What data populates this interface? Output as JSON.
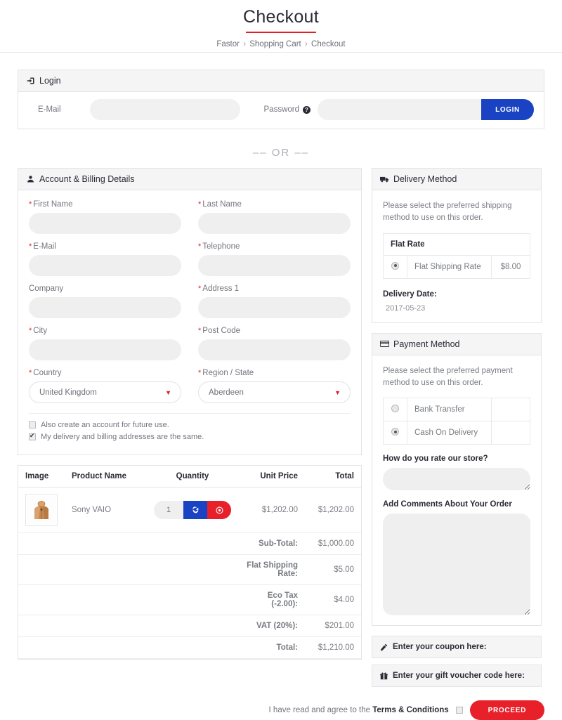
{
  "header": {
    "title": "Checkout",
    "breadcrumb": [
      "Fastor",
      "Shopping Cart",
      "Checkout"
    ],
    "separator": "›",
    "accent_color": "#e02127"
  },
  "login": {
    "panel_title": "Login",
    "icon": "sign-in-icon",
    "email_label": "E-Mail",
    "email_value": "",
    "password_label": "Password",
    "password_help_icon": "question-circle-icon",
    "password_value": "",
    "button_label": "LOGIN",
    "button_color": "#1a43c4"
  },
  "divider": {
    "text": "–– OR ––"
  },
  "billing": {
    "panel_title": "Account & Billing Details",
    "icon": "user-icon",
    "fields": [
      {
        "label": "First Name",
        "required": true,
        "value": "",
        "type": "text"
      },
      {
        "label": "Last Name",
        "required": true,
        "value": "",
        "type": "text"
      },
      {
        "label": "E-Mail",
        "required": true,
        "value": "",
        "type": "text"
      },
      {
        "label": "Telephone",
        "required": true,
        "value": "",
        "type": "text"
      },
      {
        "label": "Company",
        "required": false,
        "value": "",
        "type": "text"
      },
      {
        "label": "Address 1",
        "required": true,
        "value": "",
        "type": "text"
      },
      {
        "label": "City",
        "required": true,
        "value": "",
        "type": "text"
      },
      {
        "label": "Post Code",
        "required": true,
        "value": "",
        "type": "text"
      },
      {
        "label": "Country",
        "required": true,
        "value": "United Kingdom",
        "type": "select"
      },
      {
        "label": "Region / State",
        "required": true,
        "value": "Aberdeen",
        "type": "select"
      }
    ],
    "checkboxes": [
      {
        "label": "Also create an account for future use.",
        "checked": false
      },
      {
        "label": "My delivery and billing addresses are the same.",
        "checked": true
      }
    ]
  },
  "cart": {
    "columns": [
      "Image",
      "Product Name",
      "Quantity",
      "Unit Price",
      "Total"
    ],
    "rows": [
      {
        "product_name": "Sony VAIO",
        "quantity": "1",
        "unit_price": "$1,202.00",
        "total": "$1,202.00",
        "refresh_icon": "refresh-icon",
        "remove_icon": "remove-icon"
      }
    ],
    "totals": [
      {
        "label": "Sub-Total:",
        "value": "$1,000.00"
      },
      {
        "label": "Flat Shipping Rate:",
        "value": "$5.00"
      },
      {
        "label": "Eco Tax (-2.00):",
        "value": "$4.00"
      },
      {
        "label": "VAT (20%):",
        "value": "$201.00"
      },
      {
        "label": "Total:",
        "value": "$1,210.00"
      }
    ]
  },
  "delivery": {
    "panel_title": "Delivery Method",
    "icon": "truck-icon",
    "hint": "Please select the preferred shipping method to use on this order.",
    "group_title": "Flat Rate",
    "options": [
      {
        "name": "Flat Shipping Rate",
        "price": "$8.00",
        "selected": true
      }
    ],
    "date_label": "Delivery Date:",
    "date_value": "2017-05-23"
  },
  "payment": {
    "panel_title": "Payment Method",
    "icon": "credit-card-icon",
    "hint": "Please select the preferred payment method to use on this order.",
    "options": [
      {
        "name": "Bank Transfer",
        "selected": false
      },
      {
        "name": "Cash On Delivery",
        "selected": true
      }
    ],
    "rate_label": "How do you rate our store?",
    "rate_value": "",
    "comments_label": "Add Comments About Your Order",
    "comments_value": ""
  },
  "strips": [
    {
      "label": "Enter your coupon here:",
      "icon": "pencil-icon"
    },
    {
      "label": "Enter your gift voucher code here:",
      "icon": "gift-icon"
    }
  ],
  "footer": {
    "terms_prefix": "I have read and agree to the ",
    "terms_link": "Terms & Conditions",
    "terms_checked": false,
    "proceed_label": "PROCEED",
    "proceed_color": "#e8202a"
  }
}
